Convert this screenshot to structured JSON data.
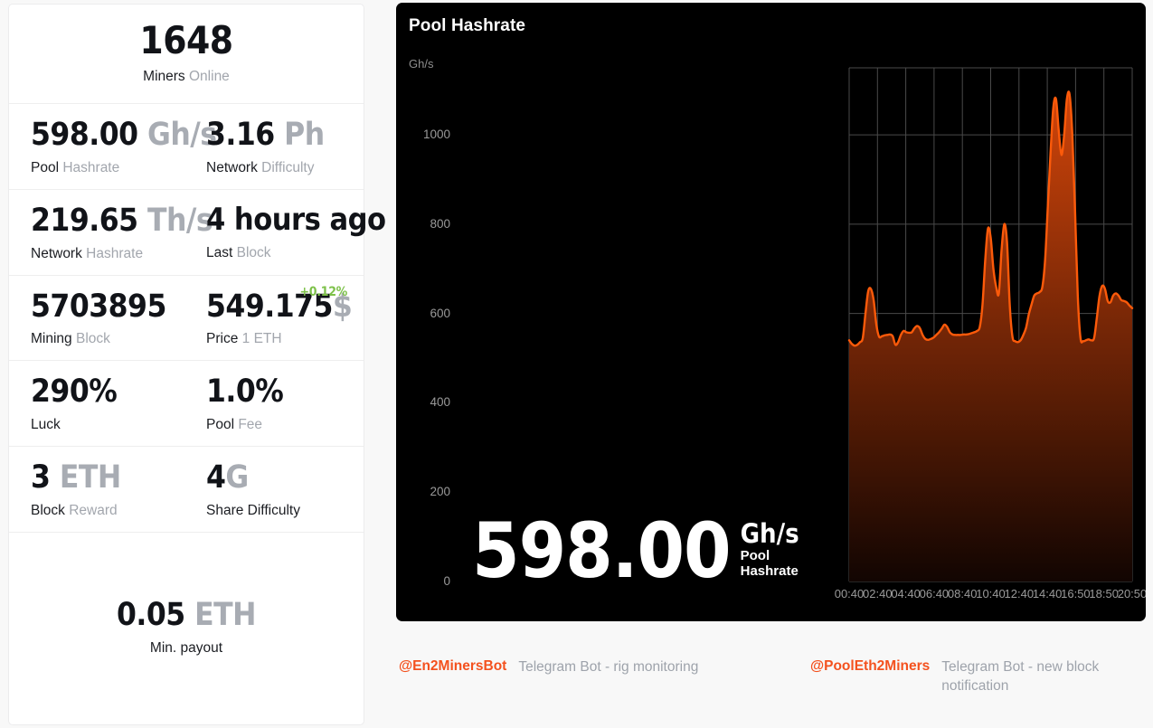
{
  "sidebar": {
    "top": {
      "value": "1648",
      "label_strong": "Miners",
      "label_muted": "Online"
    },
    "rows": [
      {
        "left": {
          "value": "598.00",
          "unit": "Gh/s",
          "label_strong": "Pool",
          "label_muted": "Hashrate"
        },
        "right": {
          "value": "3.16",
          "unit": "Ph",
          "label_strong": "Network",
          "label_muted": "Difficulty"
        }
      },
      {
        "left": {
          "value": "219.65",
          "unit": "Th/s",
          "label_strong": "Network",
          "label_muted": "Hashrate"
        },
        "right": {
          "value": "4 hours ago",
          "unit": "",
          "label_strong": "Last",
          "label_muted": "Block"
        }
      },
      {
        "left": {
          "value": "5703895",
          "unit": "",
          "label_strong": "Mining",
          "label_muted": "Block"
        },
        "right": {
          "value": "549.175",
          "unit": "$",
          "label_strong": "Price",
          "label_muted": "1 ETH",
          "delta": "+0.12%",
          "delta_color": "#7dc14a"
        }
      },
      {
        "left": {
          "value": "290%",
          "unit": "",
          "label_strong": "Luck",
          "label_muted": ""
        },
        "right": {
          "value": "1.0%",
          "unit": "",
          "label_strong": "Pool",
          "label_muted": "Fee"
        }
      },
      {
        "left": {
          "value": "3",
          "unit": "ETH",
          "label_strong": "Block",
          "label_muted": "Reward"
        },
        "right": {
          "value": "4",
          "unit": "G",
          "label_strong": "Share Difficulty",
          "label_muted": ""
        }
      }
    ],
    "bottom": {
      "value": "0.05",
      "unit": "ETH",
      "label_strong": "Min. payout",
      "label_muted": ""
    }
  },
  "chart": {
    "title": "Pool Hashrate",
    "overlay_value": "598.00",
    "overlay_unit": "Gh/s",
    "overlay_sub_line1": "Pool",
    "overlay_sub_line2": "Hashrate",
    "line_color": "#fc5a0a",
    "fill_top_color": "#d2450a",
    "fill_bottom_color": "#120502",
    "background": "#000000",
    "grid_color": "#4a4a4a"
  },
  "footer": {
    "links": [
      {
        "handle": "@En2MinersBot",
        "description": "Telegram Bot - rig monitoring"
      },
      {
        "handle": "@PoolEth2Miners",
        "description": "Telegram Bot - new block notification"
      }
    ],
    "link_color": "#f4511e"
  },
  "chart_data": {
    "type": "area",
    "title": "Pool Hashrate",
    "xlabel": "",
    "ylabel": "Gh/s",
    "ylim": [
      0,
      1150
    ],
    "grid": true,
    "legend": "none",
    "yticks": [
      0,
      200,
      400,
      600,
      800,
      1000
    ],
    "xticks": [
      "00:40",
      "02:40",
      "04:40",
      "06:40",
      "08:40",
      "10:40",
      "12:40",
      "14:40",
      "16:50",
      "18:50",
      "20:50"
    ],
    "current_value": 598.0,
    "unit": "Gh/s",
    "series": [
      {
        "name": "Pool Hashrate",
        "values": [
          540,
          532,
          528,
          530,
          536,
          545,
          600,
          650,
          655,
          630,
          575,
          548,
          549,
          551,
          552,
          553,
          549,
          530,
          536,
          552,
          561,
          558,
          557,
          558,
          567,
          572,
          567,
          552,
          543,
          541,
          543,
          546,
          552,
          558,
          566,
          575,
          570,
          558,
          553,
          552,
          552,
          552,
          553,
          553,
          554,
          556,
          558,
          561,
          570,
          620,
          720,
          790,
          770,
          700,
          660,
          645,
          742,
          800,
          760,
          620,
          548,
          538,
          536,
          540,
          552,
          568,
          598,
          620,
          640,
          645,
          648,
          660,
          720,
          840,
          960,
          1060,
          1080,
          1010,
          955,
          1000,
          1080,
          1090,
          1000,
          830,
          640,
          545,
          538,
          540,
          542,
          540,
          545,
          590,
          640,
          662,
          655,
          628,
          625,
          640,
          645,
          640,
          630,
          628,
          625,
          618,
          612
        ]
      }
    ]
  }
}
